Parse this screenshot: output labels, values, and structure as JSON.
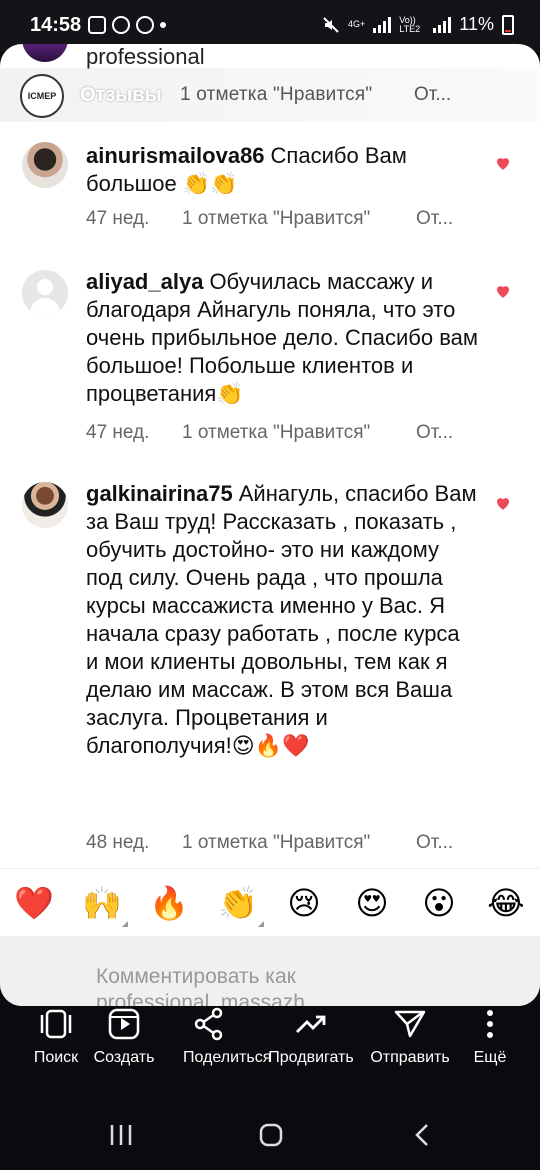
{
  "status_bar": {
    "time": "14:58",
    "network_label": "4G+",
    "volte_label": "Vo)) LTE2",
    "battery": "11%"
  },
  "pinned": {
    "previous_text": "professional",
    "caption": "Отзывы",
    "likes": "1 отметка \"Нравится\"",
    "reply": "От..."
  },
  "comments": [
    {
      "username": "ainurismailova86",
      "text": "Спасибо Вам большое 👏👏",
      "age": "47 нед.",
      "likes": "1 отметка \"Нравится\"",
      "reply": "От..."
    },
    {
      "username": "aliyad_alya",
      "text": "Обучилась массажу и благодаря Айнагуль поняла, что это очень прибыльное дело. Спасибо вам большое! Побольше клиентов и процветания👏",
      "age": "47 нед.",
      "likes": "1 отметка \"Нравится\"",
      "reply": "От..."
    },
    {
      "username": "galkinairina75",
      "text": "Айнагуль, спасибо Вам за Ваш труд! Рассказать , показать , обучить достойно- это ни каждому под силу. Очень рада , что прошла курсы массажиста именно у Вас. Я начала сразу работать , после курса и мои клиенты довольны, тем как я делаю им массаж. В этом вся Ваша заслуга. Процветания и благополучия!😍🔥❤️",
      "age": "48 нед.",
      "likes": "1 отметка \"Нравится\"",
      "reply": "От..."
    }
  ],
  "emoji_bar": [
    "❤️",
    "🙌",
    "🔥",
    "👏",
    "😢",
    "😍",
    "😮",
    "😂"
  ],
  "input": {
    "placeholder": "Комментировать как professional_massazh"
  },
  "actions": {
    "search": "Поиск",
    "create": "Создать",
    "share": "Поделиться",
    "promote": "Продвигать",
    "send": "Отправить",
    "more": "Ещё"
  },
  "colors": {
    "heart": "#ed4956",
    "meta_text": "#666666",
    "sheet_bg": "#ffffff",
    "bar_bg": "#0b0b0f"
  }
}
